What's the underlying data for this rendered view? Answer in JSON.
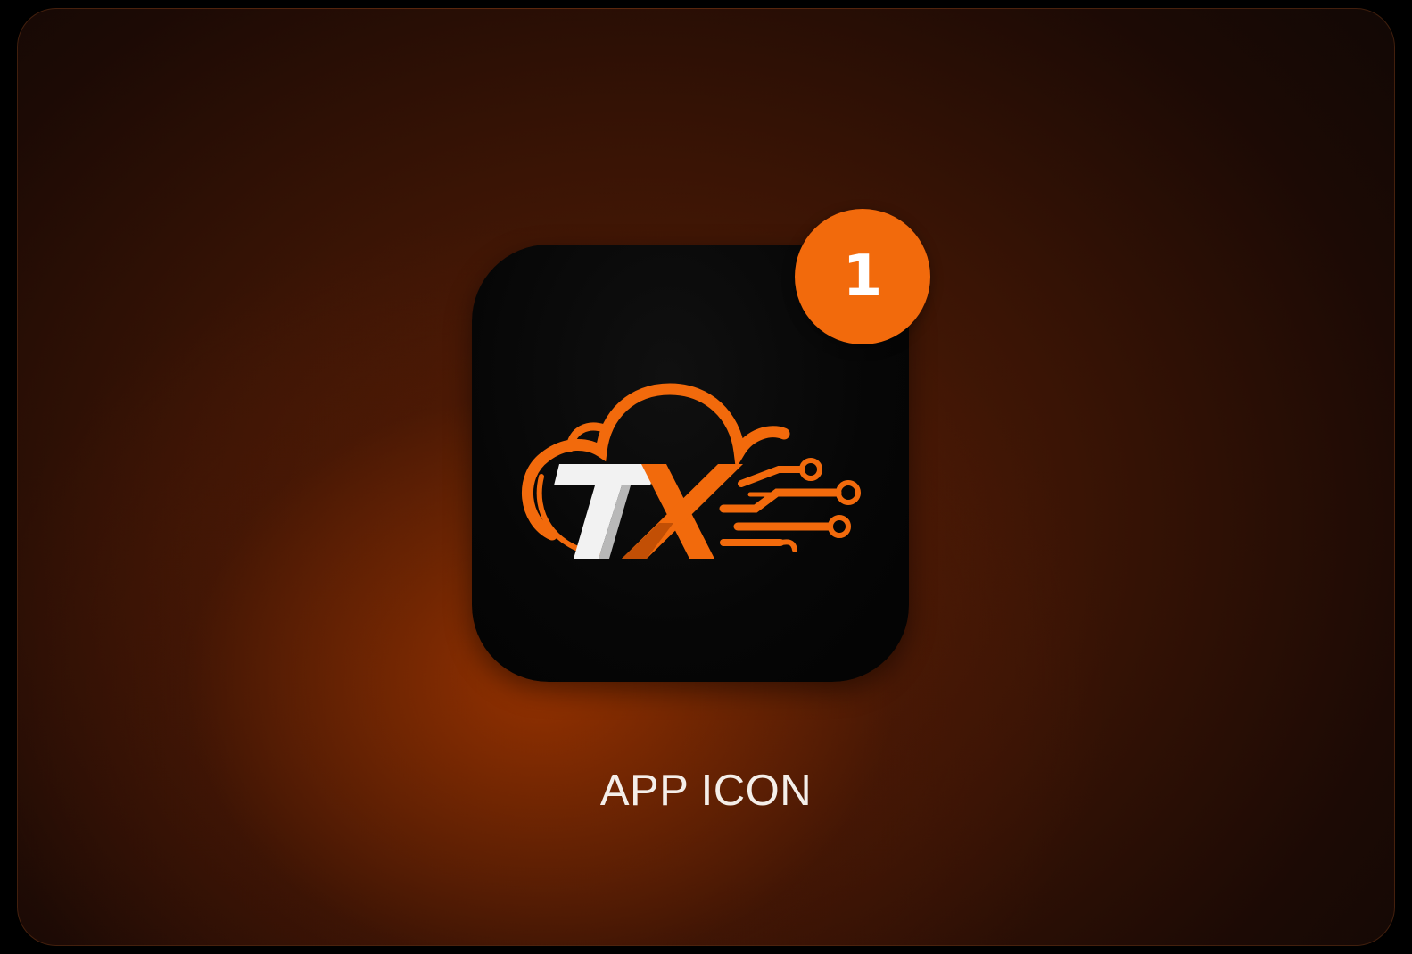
{
  "card": {
    "label": "APP ICON"
  },
  "app_icon": {
    "badge_count": "1",
    "logo_icon": "tx-cloud-circuit-logo",
    "logo_text": "TX"
  },
  "colors": {
    "accent": "#f26a0c",
    "icon_background": "#050505",
    "label_text": "#f4eee9",
    "card_gradient_center": "#963200",
    "card_gradient_edge": "#120805"
  }
}
